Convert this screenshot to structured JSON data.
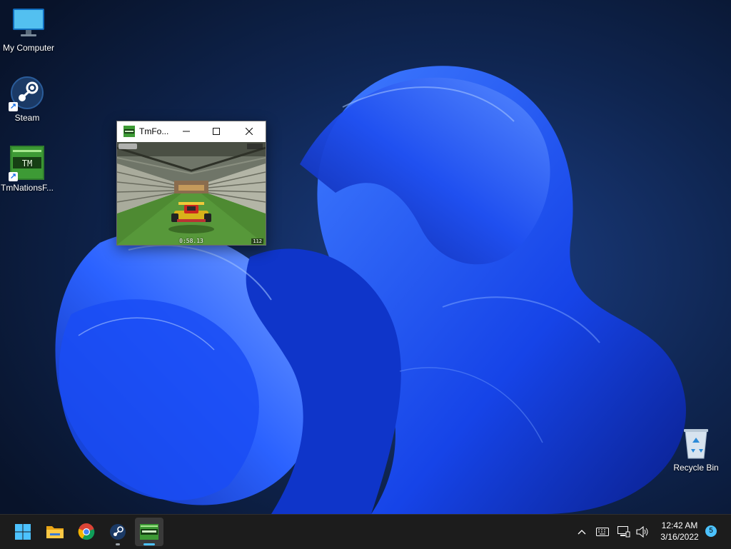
{
  "desktop": {
    "icons": [
      {
        "label": "My Computer",
        "icon": "monitor-icon"
      },
      {
        "label": "Steam",
        "icon": "steam-icon"
      },
      {
        "label": "TmNationsF...",
        "icon": "tmnations-icon"
      },
      {
        "label": "Recycle Bin",
        "icon": "recycle-bin-icon"
      }
    ]
  },
  "game_window": {
    "title": "TmFo...",
    "icon": "tmnations-icon",
    "buttons": {
      "minimize": "minimize-icon",
      "maximize": "maximize-icon",
      "close": "close-icon"
    },
    "hud": {
      "timer": "0:58.13",
      "speed": "112"
    }
  },
  "taskbar": {
    "items": [
      {
        "name": "start",
        "icon": "windows-start-icon"
      },
      {
        "name": "file-explorer",
        "icon": "folder-icon"
      },
      {
        "name": "chrome",
        "icon": "chrome-icon"
      },
      {
        "name": "steam",
        "icon": "steam-icon",
        "state": "open"
      },
      {
        "name": "tmnations",
        "icon": "tmnations-icon",
        "state": "focused"
      }
    ],
    "tray": {
      "icons": [
        "chevron-up-icon",
        "keyboard-icon",
        "network-icon",
        "volume-icon"
      ],
      "time": "12:42 AM",
      "date": "3/16/2022",
      "notification_count": "5"
    }
  },
  "colors": {
    "accent": "#4cc2ff",
    "taskbar": "#1c1c1c",
    "wallpaper_bloom": "#1f55ff",
    "wallpaper_bg": "#0b1730"
  }
}
